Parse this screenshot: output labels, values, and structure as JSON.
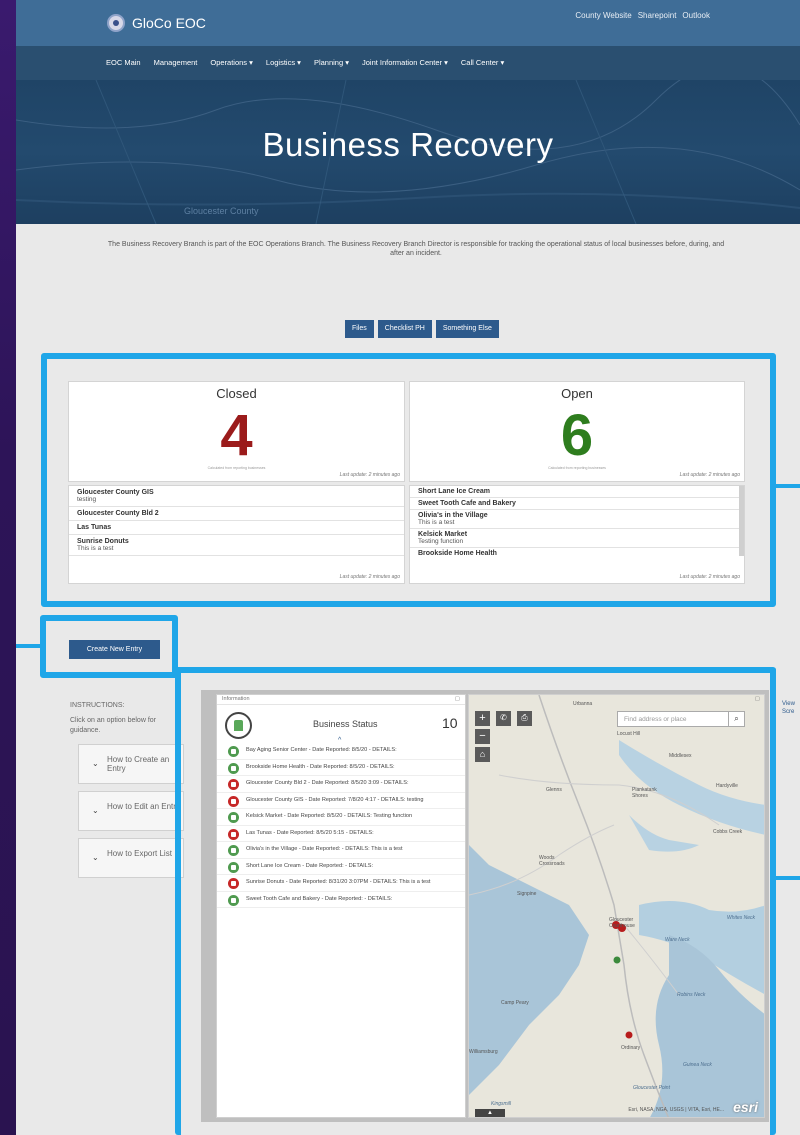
{
  "brand": "GloCo EOC",
  "top_links": [
    "County Website",
    "Sharepoint",
    "Outlook"
  ],
  "nav": [
    "EOC Main",
    "Management",
    "Operations ▾",
    "Logistics ▾",
    "Planning ▾",
    "Joint Information Center ▾",
    "Call Center ▾"
  ],
  "hero": {
    "title": "Business Recovery",
    "map_labels": [
      "Gloucester County"
    ]
  },
  "intro": "The Business Recovery Branch is part of the EOC Operations Branch. The Business Recovery Branch Director is responsible for tracking the operational status of local businesses before, during, and after an incident.",
  "buttons": [
    "Files",
    "Checklist PH",
    "Something Else"
  ],
  "closed": {
    "title": "Closed",
    "count": "4",
    "color": "#9b1b1b",
    "note": "Calculated from reporting businesses",
    "updated": "Last update: 2 minutes ago",
    "list": [
      {
        "name": "Gloucester County GIS",
        "sub": "testing"
      },
      {
        "name": "Gloucester County Bld 2",
        "sub": ""
      },
      {
        "name": "Las Tunas",
        "sub": ""
      },
      {
        "name": "Sunrise Donuts",
        "sub": "This is a test"
      }
    ],
    "list_updated": "Last update: 2 minutes ago"
  },
  "open": {
    "title": "Open",
    "count": "6",
    "color": "#2e7d1e",
    "note": "Calculated from reporting businesses",
    "updated": "Last update: 2 minutes ago",
    "list": [
      {
        "name": "Short Lane Ice Cream",
        "sub": ""
      },
      {
        "name": "Sweet Tooth Cafe and Bakery",
        "sub": ""
      },
      {
        "name": "Olivia's in the Village",
        "sub": "This is a test"
      },
      {
        "name": "Kelsick Market",
        "sub": "Testing function"
      },
      {
        "name": "Brookside Home Health",
        "sub": ""
      }
    ],
    "list_updated": "Last update: 2 minutes ago"
  },
  "create_button": "Create New Entry",
  "instructions": {
    "heading": "INSTRUCTIONS:",
    "text": "Click on an option below for guidance.",
    "items": [
      "How to Create an Entry",
      "How to Edit an Entry",
      "How to Export List"
    ]
  },
  "side_link": "View Scre",
  "dashboard": {
    "panel_header": "Information",
    "title": "Business Status",
    "count": "10",
    "rows": [
      {
        "text": "Bay Aging Senior Center - Date Reported: 8/5/20 - DETAILS:",
        "status": "open"
      },
      {
        "text": "Brookside Home Health - Date Reported: 8/5/20 - DETAILS:",
        "status": "open"
      },
      {
        "text": "Gloucester County Bld 2 - Date Reported: 8/5/20 3:09 - DETAILS:",
        "status": "closed"
      },
      {
        "text": "Gloucester County GIS - Date Reported: 7/8/20 4:17 - DETAILS: testing",
        "status": "closed"
      },
      {
        "text": "Kelsick Market - Date Reported: 8/5/20 - DETAILS: Testing function",
        "status": "open"
      },
      {
        "text": "Las Tunas - Date Reported: 8/5/20 5:15 - DETAILS:",
        "status": "closed"
      },
      {
        "text": "Olivia's in the Village - Date Reported: - DETAILS: This is a test",
        "status": "open"
      },
      {
        "text": "Short Lane Ice Cream - Date Reported: - DETAILS:",
        "status": "open"
      },
      {
        "text": "Sunrise Donuts - Date Reported: 8/31/20 3:07PM - DETAILS: This is a test",
        "status": "closed"
      },
      {
        "text": "Sweet Tooth Cafe and Bakery - Date Reported: - DETAILS:",
        "status": "open"
      }
    ],
    "status_colors": {
      "open": "#4f9a4f",
      "closed": "#c62828"
    }
  },
  "map": {
    "search_placeholder": "Find address or place",
    "labels": [
      "Urbanna",
      "Locust Hill",
      "Middlesex",
      "Hardyville",
      "Glenns",
      "Piankatank Shores",
      "Cobbs Creek",
      "Woods Crossroads",
      "Signpine",
      "Gloucester Courthouse",
      "Whites Neck",
      "Ware Neck",
      "Camp Peary",
      "Robins Neck",
      "Ordinary",
      "Guinea Neck",
      "Gloucester Point",
      "Williamsburg",
      "Kingsmill"
    ],
    "attribution": "Esri, NASA, NGA, USGS | VITA, Esri, HE...",
    "logo": "esri"
  }
}
